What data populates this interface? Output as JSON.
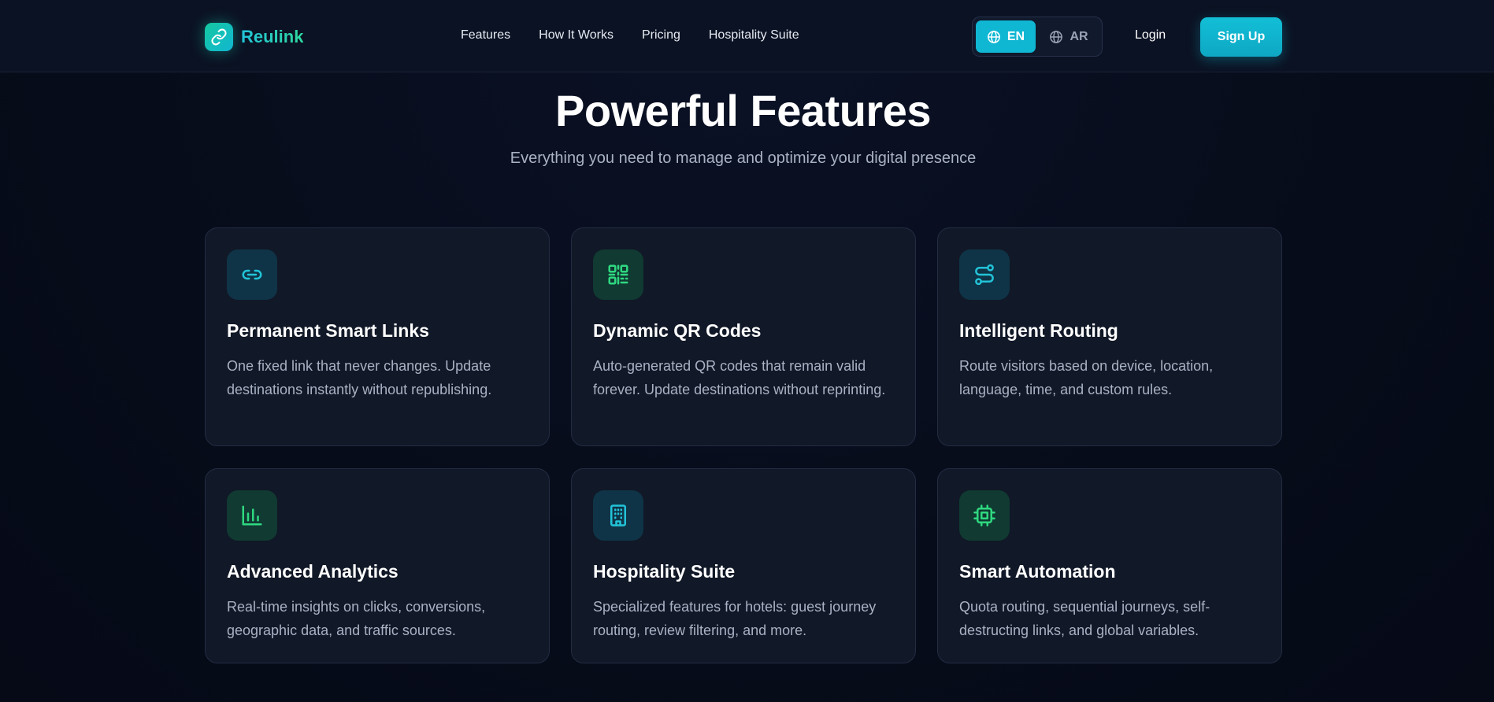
{
  "brand": {
    "name": "Reulink",
    "accent": "#12b6d2",
    "accent_green": "#2fd8a0"
  },
  "nav": {
    "items": [
      {
        "label": "Features"
      },
      {
        "label": "How It Works"
      },
      {
        "label": "Pricing"
      },
      {
        "label": "Hospitality Suite"
      }
    ]
  },
  "language": {
    "options": [
      {
        "label": "EN",
        "icon": "globe-icon",
        "selected": true
      },
      {
        "label": "AR",
        "icon": "globe-icon",
        "selected": false
      }
    ]
  },
  "auth": {
    "login_label": "Login",
    "signup_label": "Sign Up"
  },
  "hero": {
    "title": "Powerful Features",
    "subtitle": "Everything you need to manage and optimize your digital presence"
  },
  "features": [
    {
      "icon": "link-icon",
      "icon_color": "#22c3d8",
      "title": "Permanent Smart Links",
      "description": "One fixed link that never changes. Update destinations instantly without republishing."
    },
    {
      "icon": "qr-code-icon",
      "icon_color": "#2fd880",
      "title": "Dynamic QR Codes",
      "description": "Auto-generated QR codes that remain valid forever. Update destinations without reprinting."
    },
    {
      "icon": "route-icon",
      "icon_color": "#22c3d8",
      "title": "Intelligent Routing",
      "description": "Route visitors based on device, location, language, time, and custom rules."
    },
    {
      "icon": "bar-chart-icon",
      "icon_color": "#2fd880",
      "title": "Advanced Analytics",
      "description": "Real-time insights on clicks, conversions, geographic data, and traffic sources."
    },
    {
      "icon": "building-icon",
      "icon_color": "#22c3d8",
      "title": "Hospitality Suite",
      "description": "Specialized features for hotels: guest journey routing, review filtering, and more."
    },
    {
      "icon": "chip-icon",
      "icon_color": "#2fd880",
      "title": "Smart Automation",
      "description": "Quota routing, sequential journeys, self-destructing links, and global variables."
    }
  ]
}
